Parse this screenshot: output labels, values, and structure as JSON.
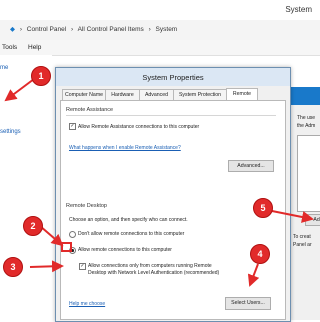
{
  "window": {
    "title": "System"
  },
  "breadcrumb": [
    "Control Panel",
    "All Control Panel Items",
    "System"
  ],
  "menu": [
    "Tools",
    "Help"
  ],
  "left_pane": {
    "home": "me",
    "settings": "settings"
  },
  "dialog": {
    "title": "System Properties",
    "tabs": [
      "Computer Name",
      "Hardware",
      "Advanced",
      "System Protection",
      "Remote"
    ],
    "active_tab": "Remote",
    "remote_assistance": {
      "group": "Remote Assistance",
      "allow_label": "Allow Remote Assistance connections to this computer",
      "link": "What happens when I enable Remote Assistance?",
      "advanced_button": "Advanced..."
    },
    "remote_desktop": {
      "group": "Remote Desktop",
      "hint": "Choose an option, and then specify who can connect.",
      "option_dont": "Don't allow remote connections to this computer",
      "option_allow": "Allow remote connections to this computer",
      "nla_line1": "Allow connections only from computers running Remote",
      "nla_line2": "Desktop with Network Level Authentication (recommended)",
      "help_link": "Help me choose",
      "select_users_button": "Select Users..."
    }
  },
  "side_dialog": {
    "text1": "The use",
    "text2": "the Adm",
    "add_button": "Add",
    "text3": "To creat",
    "text4": "Panel ar"
  },
  "annotations": [
    "1",
    "2",
    "3",
    "4",
    "5"
  ],
  "colors": {
    "annotation": "#e12a2a",
    "link": "#1a5fb4",
    "accent": "#1979ca"
  }
}
